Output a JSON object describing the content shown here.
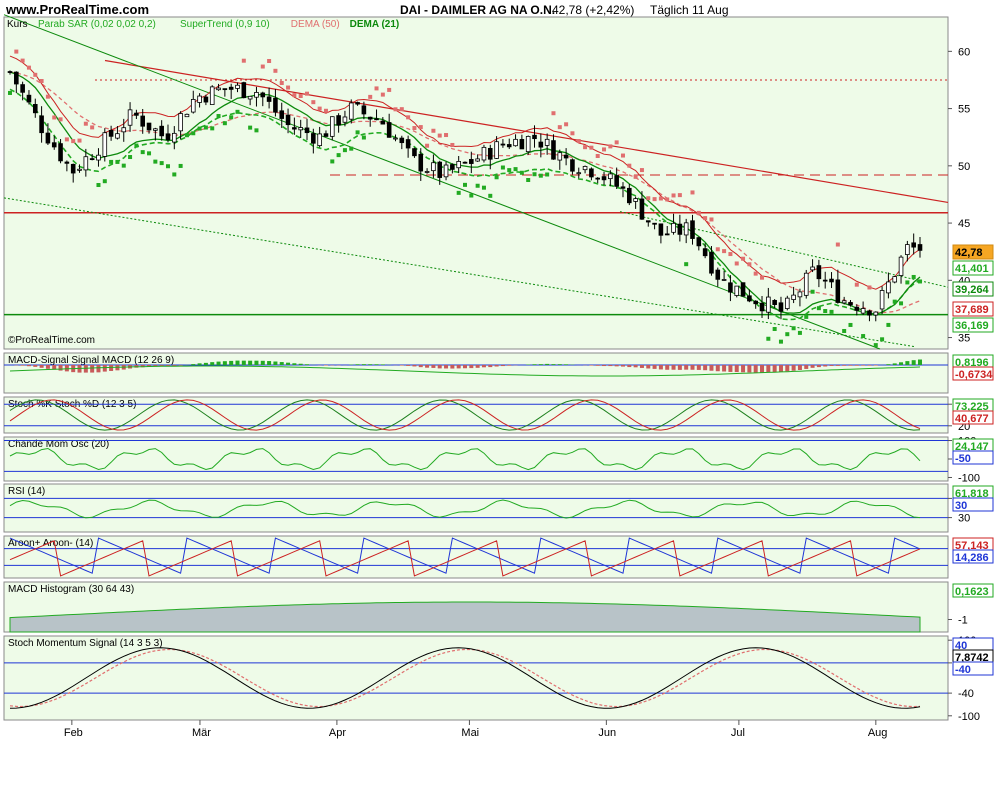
{
  "header": {
    "brand": "www.ProRealTime.com",
    "ticker": "DAI - DAIMLER AG NA O.N.",
    "last": "42,78 (+2,42%)",
    "period": "Täglich  11 Aug"
  },
  "watermark": "©ProRealTime.com",
  "colors": {
    "panel_bg": "#eefbe8",
    "green": "#22aa22",
    "dark_green": "#0c8a0c",
    "red": "#cc2222",
    "pink": "#e06f6f",
    "blue": "#1f35d6",
    "gray_fill": "#b8c3c8"
  },
  "months": [
    "Feb",
    "Mär",
    "Apr",
    "Mai",
    "Jun",
    "Jul",
    "Aug"
  ],
  "price_panel": {
    "title_prefix": "Kurs",
    "legend": [
      {
        "label": "Parab SAR (0,02 0,02 0,2)",
        "color": "#22aa22"
      },
      {
        "label": "SuperTrend (0,9 10)",
        "color": "#22aa22"
      },
      {
        "label": "DEMA (50)",
        "color": "#e06f6f"
      },
      {
        "label": "DEMA (21)",
        "color": "#0c8a0c"
      }
    ],
    "ticks": [
      "60",
      "55",
      "50",
      "45",
      "40",
      "35"
    ],
    "badges": [
      {
        "text": "42,78",
        "bg": "#f6a623",
        "fg": "#000000"
      },
      {
        "text": "41,401",
        "bg": "#ffffff",
        "fg": "#22aa22"
      },
      {
        "text": "39,264",
        "bg": "#ffffff",
        "fg": "#0c8a0c"
      },
      {
        "text": "37,689",
        "bg": "#ffffff",
        "fg": "#cc2222"
      },
      {
        "text": "36,169",
        "bg": "#ffffff",
        "fg": "#22aa22"
      }
    ]
  },
  "indicators": [
    {
      "id": "macd_signal",
      "title": "MACD-Signal Signal MACD (12 26 9)",
      "ticks": [],
      "badges": [
        {
          "text": "0,8196",
          "fg": "#22aa22"
        },
        {
          "text": "-0,6734",
          "fg": "#cc2222"
        }
      ]
    },
    {
      "id": "stoch",
      "title": "Stoch %K Stoch %D (12 3 5)",
      "ticks": [
        "80",
        "20"
      ],
      "badges": [
        {
          "text": "73,225",
          "fg": "#22aa22"
        },
        {
          "text": "40,677",
          "fg": "#cc2222"
        }
      ]
    },
    {
      "id": "chande",
      "title": "Chande Mom Osc (20)",
      "ticks": [
        "100",
        "50",
        "-100"
      ],
      "badges": [
        {
          "text": "24,147",
          "fg": "#22aa22"
        },
        {
          "text": "-50",
          "fg": "#1f35d6"
        }
      ]
    },
    {
      "id": "rsi",
      "title": "RSI (14)",
      "ticks": [
        "70",
        "30"
      ],
      "badges": [
        {
          "text": "61,818",
          "fg": "#22aa22"
        },
        {
          "text": "30",
          "fg": "#1f35d6"
        }
      ]
    },
    {
      "id": "aroon",
      "title": "Aroon+ Aroon- (14)",
      "ticks": [],
      "badges": [
        {
          "text": "57,143",
          "fg": "#cc2222"
        },
        {
          "text": "14,286",
          "fg": "#1f35d6"
        }
      ]
    },
    {
      "id": "macd_hist",
      "title": "MACD Histogram (30 64 43)",
      "ticks": [
        "-1"
      ],
      "badges": [
        {
          "text": "0,1623",
          "fg": "#22aa22"
        }
      ]
    },
    {
      "id": "stoch_mom",
      "title": "Stoch Momentum Signal (14 3 5 3)",
      "ticks": [
        "100",
        "40",
        "-40",
        "-100"
      ],
      "badges": [
        {
          "text": "40",
          "fg": "#1f35d6"
        },
        {
          "text": "7,8742",
          "fg": "#000000"
        },
        {
          "text": "-40",
          "fg": "#1f35d6"
        }
      ]
    }
  ],
  "chart_data": {
    "type": "candlestick",
    "x_start_date": "2016-01-18",
    "x_end_date": "2016-08-11",
    "y_range": [
      34,
      63
    ],
    "close_series": [
      {
        "date": "2016-01-18",
        "close": 58.2
      },
      {
        "date": "2016-01-25",
        "close": 53.5
      },
      {
        "date": "2016-02-01",
        "close": 49.5
      },
      {
        "date": "2016-02-08",
        "close": 52.0
      },
      {
        "date": "2016-02-15",
        "close": 54.5
      },
      {
        "date": "2016-02-22",
        "close": 52.5
      },
      {
        "date": "2016-02-29",
        "close": 56.0
      },
      {
        "date": "2016-03-07",
        "close": 56.8
      },
      {
        "date": "2016-03-14",
        "close": 56.5
      },
      {
        "date": "2016-03-21",
        "close": 53.5
      },
      {
        "date": "2016-03-28",
        "close": 52.5
      },
      {
        "date": "2016-04-04",
        "close": 55.0
      },
      {
        "date": "2016-04-11",
        "close": 54.0
      },
      {
        "date": "2016-04-18",
        "close": 50.5
      },
      {
        "date": "2016-04-25",
        "close": 49.2
      },
      {
        "date": "2016-05-02",
        "close": 50.5
      },
      {
        "date": "2016-05-09",
        "close": 52.0
      },
      {
        "date": "2016-05-16",
        "close": 52.5
      },
      {
        "date": "2016-05-23",
        "close": 50.5
      },
      {
        "date": "2016-05-30",
        "close": 49.5
      },
      {
        "date": "2016-06-06",
        "close": 47.5
      },
      {
        "date": "2016-06-13",
        "close": 44.0
      },
      {
        "date": "2016-06-20",
        "close": 44.5
      },
      {
        "date": "2016-06-27",
        "close": 40.0
      },
      {
        "date": "2016-07-04",
        "close": 38.5
      },
      {
        "date": "2016-07-11",
        "close": 37.2
      },
      {
        "date": "2016-07-18",
        "close": 40.8
      },
      {
        "date": "2016-07-25",
        "close": 38.2
      },
      {
        "date": "2016-08-01",
        "close": 37.5
      },
      {
        "date": "2016-08-08",
        "close": 42.78
      }
    ],
    "horizontal_lines": [
      {
        "y": 57.5,
        "style": "dotted"
      },
      {
        "y": 49.2,
        "style": "dashed"
      },
      {
        "y": 45.9,
        "style": "solid"
      },
      {
        "y": 37.0,
        "style": "solid"
      }
    ]
  }
}
